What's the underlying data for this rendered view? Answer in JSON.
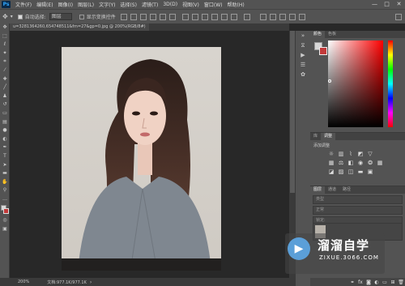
{
  "app": {
    "logo": "Ps"
  },
  "menu": [
    "文件(F)",
    "编辑(E)",
    "图像(I)",
    "图层(L)",
    "文字(Y)",
    "选择(S)",
    "滤镜(T)",
    "3D(D)",
    "视图(V)",
    "窗口(W)",
    "帮助(H)"
  ],
  "window_controls": {
    "minimize": "—",
    "maximize": "□",
    "close": "✕"
  },
  "options": {
    "auto_select_label": "自动选择:",
    "auto_select_value": "图层",
    "transform_label": "显示变换控件"
  },
  "document": {
    "tab_title": "u=3281364260,654748511&fm=27&gp=0.jpg @ 200%(RGB/8#)"
  },
  "status": {
    "zoom": "200%",
    "doc": "文档:977.1K/977.1K"
  },
  "panels": {
    "color_tabs": [
      "颜色",
      "色板"
    ],
    "adjust_tabs": [
      "库",
      "调整"
    ],
    "adjust_label": "添加调整",
    "layer_tabs": [
      "图层",
      "通道",
      "路径"
    ],
    "layer_kind": "类型",
    "layer_mode": "正常",
    "layer_lock": "锁定:"
  },
  "colors": {
    "accent": "#31a8ff",
    "foreground": "#d7d7d7",
    "background": "#c23a3a"
  },
  "watermark": {
    "title": "溜溜自学",
    "subtitle": "ZIXUE.3066.COM",
    "icon": "play-icon"
  },
  "tools": [
    "move-icon",
    "marquee-icon",
    "lasso-icon",
    "wand-icon",
    "crop-icon",
    "eyedropper-icon",
    "healing-icon",
    "brush-icon",
    "stamp-icon",
    "history-brush-icon",
    "eraser-icon",
    "gradient-icon",
    "blur-icon",
    "dodge-icon",
    "pen-icon",
    "type-icon",
    "path-select-icon",
    "shape-icon",
    "hand-icon",
    "zoom-icon",
    "more-icon",
    "color-swatch-icon",
    "quickmask-icon",
    "screen-mode-icon"
  ]
}
